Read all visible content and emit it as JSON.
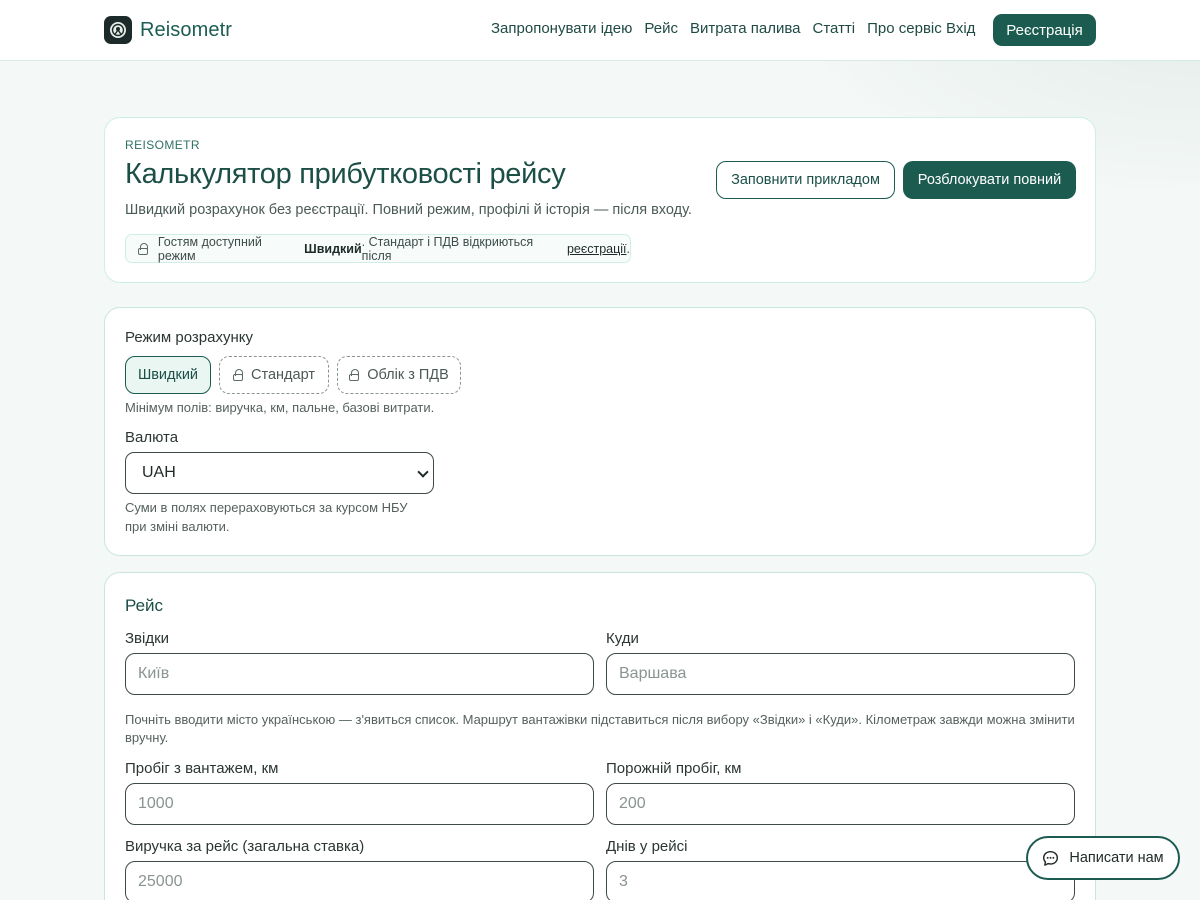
{
  "header": {
    "brand": "Reisometr",
    "nav": [
      "Запропонувати ідею",
      "Рейс",
      "Витрата палива",
      "Статті",
      "Про сервіс"
    ],
    "login": "Вхід",
    "register": "Реєстрація"
  },
  "hero": {
    "eyebrow": "REISOMETR",
    "title": "Калькулятор прибутковості рейсу",
    "subtitle": "Швидкий розрахунок без реєстрації. Повний режим, профілі й історія — після входу.",
    "guest_prefix": "Гостям доступний режим",
    "guest_mode": "Швидкий",
    "guest_middle": ". Стандарт і ПДВ відкриються після",
    "guest_link": "реєстрації",
    "guest_suffix": ".",
    "fill_example": "Заповнити прикладом",
    "unlock_full": "Розблокувати повний"
  },
  "mode": {
    "label": "Режим розрахунку",
    "options": [
      "Швидкий",
      "Стандарт",
      "Облік з ПДВ"
    ],
    "hint": "Мінімум полів: виручка, км, пальне, базові витрати.",
    "currency_label": "Валюта",
    "currency_value": "UAH",
    "currency_hint": "Суми в полях перераховуються за курсом НБУ при зміні валюти."
  },
  "trip": {
    "title": "Рейс",
    "from_label": "Звідки",
    "from_placeholder": "Київ",
    "to_label": "Куди",
    "to_placeholder": "Варшава",
    "route_hint": "Почніть вводити місто українською — з'явиться список. Маршрут вантажівки підставиться після вибору «Звідки» і «Куди». Кілометраж завжди можна змінити вручну.",
    "loaded_label": "Пробіг з вантажем, км",
    "loaded_placeholder": "1000",
    "empty_label": "Порожній пробіг, км",
    "empty_placeholder": "200",
    "revenue_label": "Виручка за рейс (загальна ставка)",
    "revenue_placeholder": "25000",
    "days_label": "Днів у рейсі",
    "days_placeholder": "3"
  },
  "chat": {
    "label": "Написати нам"
  }
}
